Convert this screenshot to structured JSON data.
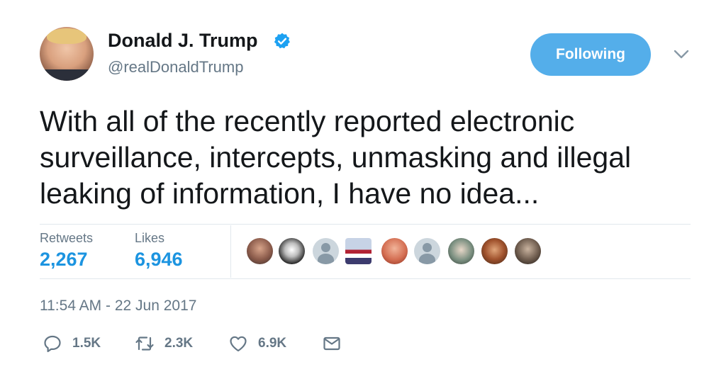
{
  "author": {
    "name": "Donald J. Trump",
    "handle": "@realDonaldTrump",
    "verified": true
  },
  "follow_button": {
    "label": "Following"
  },
  "tweet": {
    "text": "With all of the recently reported electronic surveillance, intercepts, unmasking and illegal leaking of information, I have no idea...",
    "timestamp": "11:54 AM - 22 Jun 2017"
  },
  "stats": {
    "retweets_label": "Retweets",
    "retweets_value": "2,267",
    "likes_label": "Likes",
    "likes_value": "6,946"
  },
  "likers": [
    "liker-1",
    "liker-2",
    "liker-3",
    "liker-4",
    "liker-5",
    "liker-6",
    "liker-7",
    "liker-8",
    "liker-9"
  ],
  "actions": {
    "reply_count": "1.5K",
    "retweet_count": "2.3K",
    "like_count": "6.9K"
  },
  "icons": [
    "verified-badge-icon",
    "chevron-down-icon",
    "reply-icon",
    "retweet-icon",
    "heart-icon",
    "mail-icon"
  ],
  "colors": {
    "accent": "#1da1f2",
    "button": "#54aeea",
    "secondary_text": "#657786",
    "stat_value": "#1c94e0",
    "divider": "#e1e8ed"
  }
}
